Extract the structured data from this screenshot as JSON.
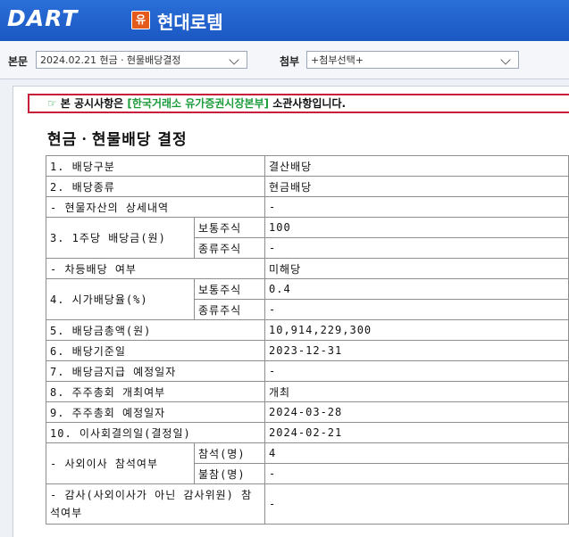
{
  "header": {
    "logo_left": "DART",
    "corp_badge": "유",
    "corp_name": "현대로템"
  },
  "toolbar": {
    "body_label": "본문",
    "body_select": "2024.02.21  현금ㆍ현물배당결정",
    "attach_label": "첨부",
    "attach_select": "+첨부선택+"
  },
  "notice": {
    "hand": "☞",
    "pre": "본 공시사항은 ",
    "highlight": "[한국거래소 유가증권시장본부]",
    "post": " 소관사항입니다."
  },
  "doc_title": "현금ㆍ현물배당 결정",
  "table": {
    "r1": {
      "label": "1. 배당구분",
      "value": "결산배당"
    },
    "r2": {
      "label": "2. 배당종류",
      "value": "현금배당"
    },
    "r3": {
      "label": "- 현물자산의 상세내역",
      "value": "-"
    },
    "r4": {
      "label": "3. 1주당 배당금(원)",
      "sub1": "보통주식",
      "val1": "100",
      "sub2": "종류주식",
      "val2": "-"
    },
    "r5": {
      "label": "- 차등배당 여부",
      "value": "미해당"
    },
    "r6": {
      "label": "4. 시가배당율(%)",
      "sub1": "보통주식",
      "val1": "0.4",
      "sub2": "종류주식",
      "val2": "-"
    },
    "r7": {
      "label": "5. 배당금총액(원)",
      "value": "10,914,229,300"
    },
    "r8": {
      "label": "6. 배당기준일",
      "value": "2023-12-31"
    },
    "r9": {
      "label": "7. 배당금지급 예정일자",
      "value": "-"
    },
    "r10": {
      "label": "8. 주주총회 개최여부",
      "value": "개최"
    },
    "r11": {
      "label": "9. 주주총회 예정일자",
      "value": "2024-03-28"
    },
    "r12": {
      "label": "10. 이사회결의일(결정일)",
      "value": "2024-02-21"
    },
    "r13": {
      "label": "- 사외이사 참석여부",
      "sub1": "참석(명)",
      "val1": "4",
      "sub2": "불참(명)",
      "val2": "-"
    },
    "r14": {
      "label": "- 감사(사외이사가 아닌 감사위원) 참석여부",
      "value": "-"
    }
  }
}
